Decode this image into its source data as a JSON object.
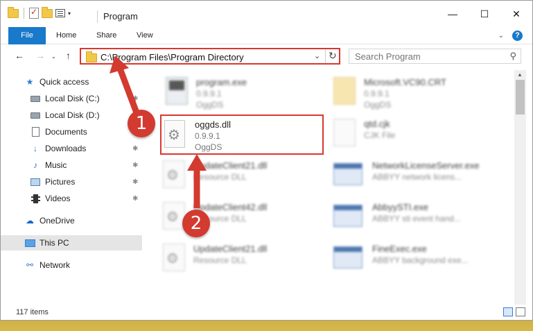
{
  "window": {
    "title": "Program",
    "minimize_glyph": "—",
    "maximize_glyph": "☐",
    "close_glyph": "✕"
  },
  "ribbon": {
    "tabs": [
      "File",
      "Home",
      "Share",
      "View"
    ],
    "expand_glyph": "⌄",
    "help_glyph": "?"
  },
  "navigation": {
    "back_glyph": "←",
    "forward_glyph": "→",
    "recent_glyph": "⌄",
    "up_glyph": "↑"
  },
  "address": {
    "path": "C:\\Program Files\\Program Directory",
    "dropdown_glyph": "⌄",
    "refresh_glyph": "↻"
  },
  "search": {
    "placeholder": "Search Program",
    "icon_glyph": "⚲"
  },
  "sidebar": {
    "items": [
      {
        "label": "Quick access",
        "icon": "star-icon",
        "glyph": "★",
        "pinned": false
      },
      {
        "label": "Local Disk (C:)",
        "icon": "drive-icon",
        "glyph": "",
        "pinned": true
      },
      {
        "label": "Local Disk (D:)",
        "icon": "drive-icon",
        "glyph": "",
        "pinned": true
      },
      {
        "label": "Documents",
        "icon": "documents-icon",
        "glyph": "",
        "pinned": true
      },
      {
        "label": "Downloads",
        "icon": "downloads-icon",
        "glyph": "↓",
        "pinned": true
      },
      {
        "label": "Music",
        "icon": "music-icon",
        "glyph": "♪",
        "pinned": true
      },
      {
        "label": "Pictures",
        "icon": "pictures-icon",
        "glyph": "",
        "pinned": true
      },
      {
        "label": "Videos",
        "icon": "videos-icon",
        "glyph": "",
        "pinned": true
      },
      {
        "label": "OneDrive",
        "icon": "cloud-icon",
        "glyph": "☁",
        "pinned": false
      },
      {
        "label": "This PC",
        "icon": "pc-icon",
        "glyph": "",
        "pinned": false,
        "selected": true
      },
      {
        "label": "Network",
        "icon": "network-icon",
        "glyph": "⚯",
        "pinned": false
      }
    ],
    "pin_glyph": "📌"
  },
  "files": [
    {
      "name": "program.exe",
      "line1": "0.9.9.1",
      "line2": "OggDS"
    },
    {
      "name": "Microsoft.VC90.CRT",
      "line1": "0.9.9.1",
      "line2": "OggDS"
    },
    {
      "name": "oggds.dll",
      "line1": "0.9.9.1",
      "line2": "OggDS"
    },
    {
      "name": "qtd.cjk",
      "line1": "CJK File",
      "line2": ""
    },
    {
      "name": "UpdateClient21.dll",
      "line1": "Resource DLL",
      "line2": ""
    },
    {
      "name": "NetworkLicenseServer.exe",
      "line1": "ABBYY network licens...",
      "line2": ""
    },
    {
      "name": "UpdateClient42.dll",
      "line1": "Resource DLL",
      "line2": ""
    },
    {
      "name": "AbbyySTI.exe",
      "line1": "ABBYY sti event hand...",
      "line2": ""
    },
    {
      "name": "UpdateClient21.dll",
      "line1": "Resource DLL",
      "line2": ""
    },
    {
      "name": "FineExec.exe",
      "line1": "ABBYY background exe...",
      "line2": ""
    }
  ],
  "status": {
    "item_count": "117 items"
  },
  "annotations": {
    "step1": "1",
    "step2": "2",
    "color": "#d33a30"
  },
  "scroll": {
    "up_glyph": "▲",
    "down_glyph": "▼"
  }
}
